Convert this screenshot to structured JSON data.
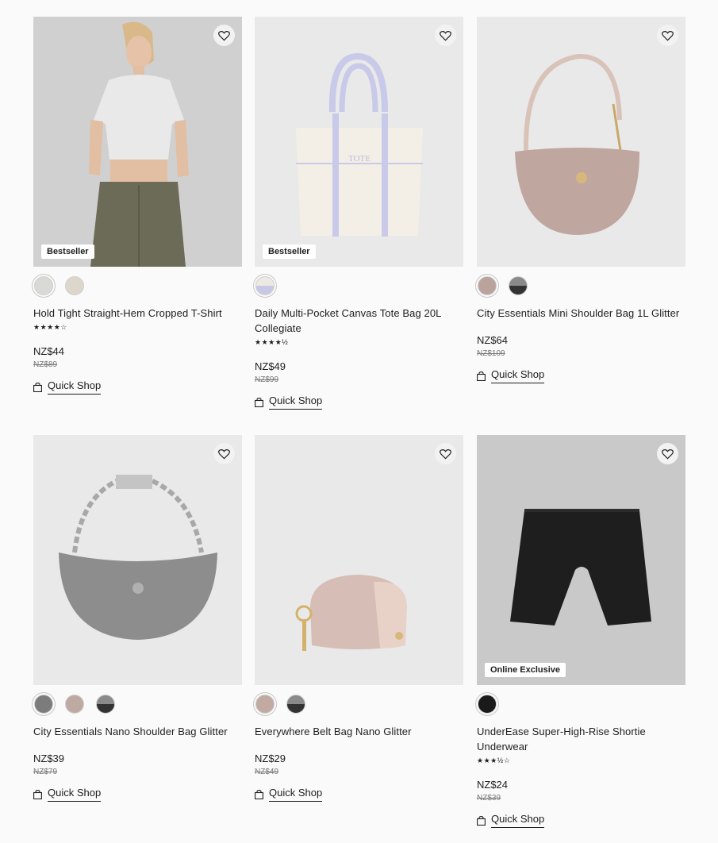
{
  "products": [
    {
      "name": "Hold Tight Straight-Hem Cropped T-Shirt",
      "badge": "Bestseller",
      "rating_stars": "★★★★☆",
      "rating": 4,
      "price": "NZ$44",
      "old_price": "NZ$89",
      "quick_shop": "Quick Shop",
      "swatches": [
        {
          "color": "#d9d9d6",
          "selected": true
        },
        {
          "color": "#ddd6cb",
          "selected": false
        }
      ]
    },
    {
      "name": "Daily Multi-Pocket Canvas Tote Bag 20L Collegiate",
      "badge": "Bestseller",
      "rating_stars": "★★★★½",
      "rating": 4.5,
      "price": "NZ$49",
      "old_price": "NZ$99",
      "quick_shop": "Quick Shop",
      "swatches": [
        {
          "color": "#ece9e1",
          "color2": "#c7c7e6",
          "selected": true
        }
      ]
    },
    {
      "name": "City Essentials Mini Shoulder Bag 1L Glitter",
      "badge": "",
      "rating_stars": "",
      "price": "NZ$64",
      "old_price": "NZ$109",
      "quick_shop": "Quick Shop",
      "swatches": [
        {
          "color": "#b9a39b",
          "selected": true
        },
        {
          "color": "#8a8a8a",
          "color2": "#333333",
          "selected": false
        }
      ]
    },
    {
      "name": "City Essentials Nano Shoulder Bag Glitter",
      "badge": "",
      "rating_stars": "",
      "price": "NZ$39",
      "old_price": "NZ$79",
      "quick_shop": "Quick Shop",
      "swatches": [
        {
          "color": "#7c7c7c",
          "selected": true
        },
        {
          "color": "#bfaaa3",
          "selected": false
        },
        {
          "color": "#8a8a8a",
          "color2": "#333333",
          "selected": false
        }
      ]
    },
    {
      "name": "Everywhere Belt Bag Nano Glitter",
      "badge": "",
      "rating_stars": "",
      "price": "NZ$29",
      "old_price": "NZ$49",
      "quick_shop": "Quick Shop",
      "swatches": [
        {
          "color": "#c1aaa2",
          "selected": true
        },
        {
          "color": "#8a8a8a",
          "color2": "#333333",
          "selected": false
        }
      ]
    },
    {
      "name": "UnderEase Super-High-Rise Shortie Underwear",
      "badge": "Online Exclusive",
      "rating_stars": "★★★½☆",
      "rating": 3.5,
      "price": "NZ$24",
      "old_price": "NZ$39",
      "quick_shop": "Quick Shop",
      "swatches": [
        {
          "color": "#1a1a1a",
          "selected": true
        }
      ]
    }
  ]
}
